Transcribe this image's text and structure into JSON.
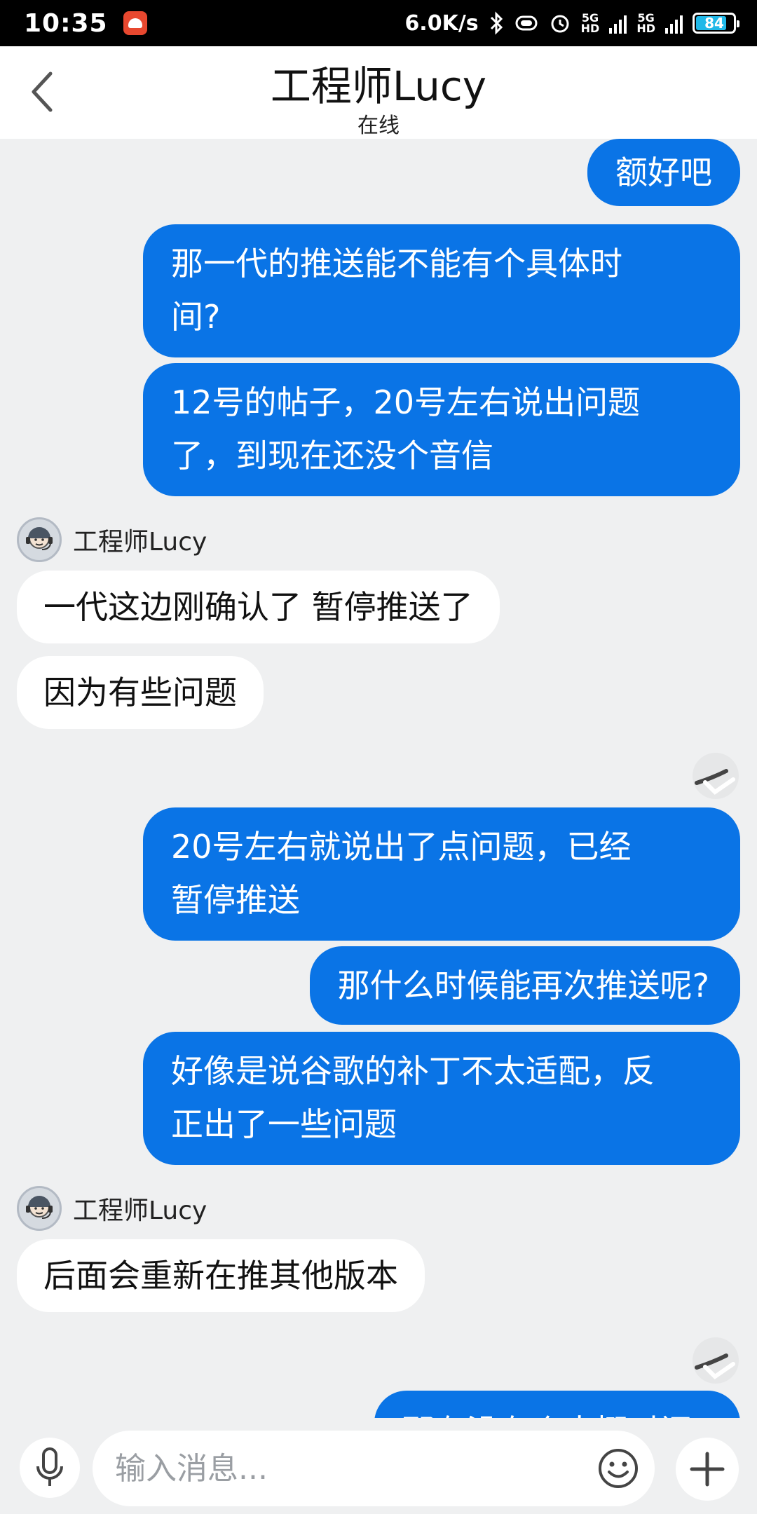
{
  "status_bar": {
    "time": "10:35",
    "speed": "6.0K/s",
    "network1": "5G\nHD",
    "network2": "5G\nHD",
    "battery": "84",
    "battery_level": 0.84,
    "battery_color": "#1fb8e8"
  },
  "header": {
    "title": "工程师Lucy",
    "subtitle": "在线"
  },
  "agent_name": "工程师Lucy",
  "messages": {
    "m1": "额好吧",
    "m2_line1": "那一代的推送能不能有个具体时",
    "m2_line2": "间?",
    "m3_line1": "12号的帖子，20号左右说出问题",
    "m3_line2": "了，到现在还没个音信",
    "m4": "一代这边刚确认了 暂停推送了",
    "m5": "因为有些问题",
    "m6_line1": "20号左右就说出了点问题，已经",
    "m6_line2": "暂停推送",
    "m7": "那什么时候能再次推送呢?",
    "m8_line1": "好像是说谷歌的补丁不太适配，反",
    "m8_line2": "正出了一些问题",
    "m9": "后面会重新在推其他版本",
    "m10_partial": "那有没有个大概时间?"
  },
  "input": {
    "placeholder": "输入消息..."
  },
  "colors": {
    "outgoing_bubble": "#0a74e6",
    "incoming_bubble": "#ffffff",
    "background": "#eff0f1"
  }
}
